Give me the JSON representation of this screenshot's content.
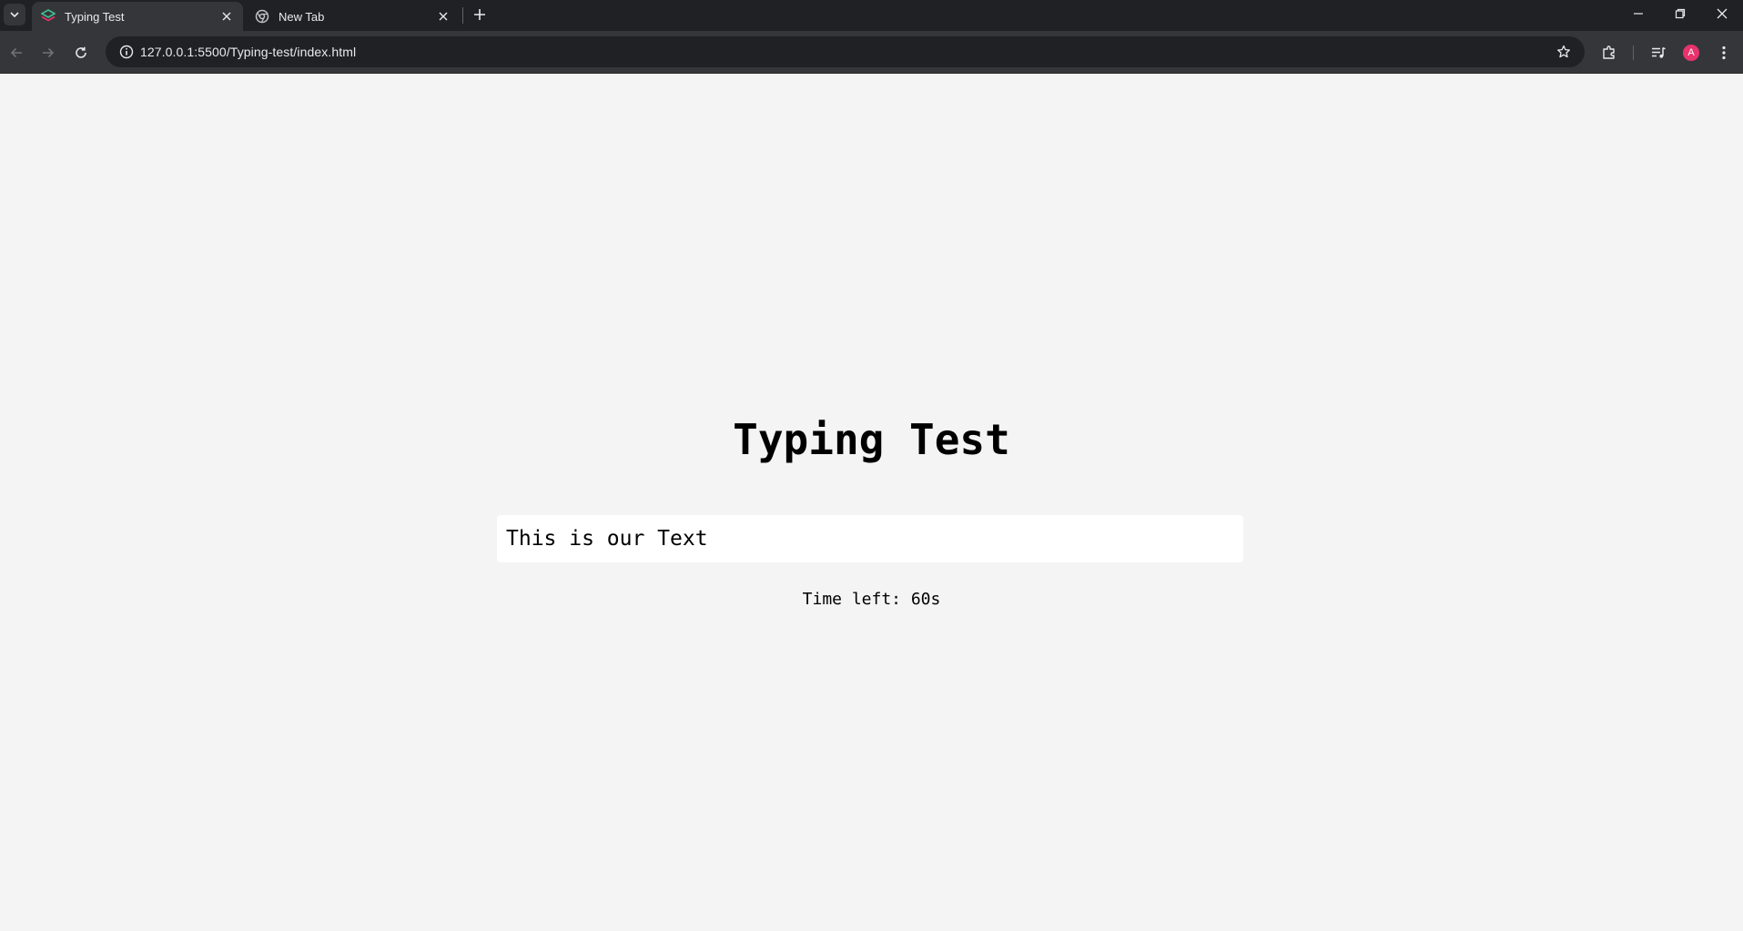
{
  "browser": {
    "tabs": [
      {
        "title": "Typing Test",
        "active": true,
        "icon": "typing-test-favicon"
      },
      {
        "title": "New Tab",
        "active": false,
        "icon": "chrome-icon"
      }
    ],
    "url": "127.0.0.1:5500/Typing-test/index.html",
    "avatar_letter": "A",
    "colors": {
      "chrome_dark": "#202124",
      "toolbar": "#35363a",
      "avatar": "#e8336d"
    }
  },
  "page": {
    "title": "Typing Test",
    "text": "This is our Text",
    "timer": "Time left: 60s",
    "colors": {
      "background": "#f4f4f4",
      "text_box": "#ffffff",
      "text": "#000000"
    }
  }
}
